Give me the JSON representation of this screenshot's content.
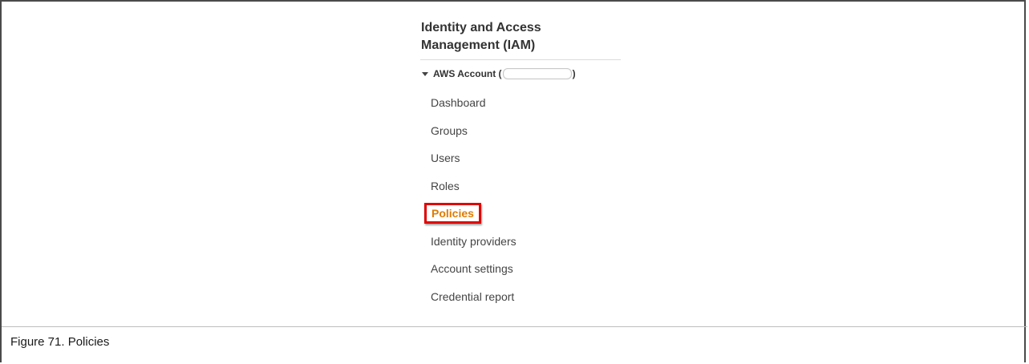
{
  "sidebar": {
    "title": "Identity and Access\nManagement (IAM)",
    "account_label": "AWS Account (",
    "account_close": ")",
    "items": [
      {
        "label": "Dashboard",
        "active": false
      },
      {
        "label": "Groups",
        "active": false
      },
      {
        "label": "Users",
        "active": false
      },
      {
        "label": "Roles",
        "active": false
      },
      {
        "label": "Policies",
        "active": true
      },
      {
        "label": "Identity providers",
        "active": false
      },
      {
        "label": "Account settings",
        "active": false
      },
      {
        "label": "Credential report",
        "active": false
      }
    ]
  },
  "caption": {
    "text": "Figure 71.  Policies"
  },
  "colors": {
    "active_item": "#e07b00",
    "highlight_border": "#e00000"
  }
}
